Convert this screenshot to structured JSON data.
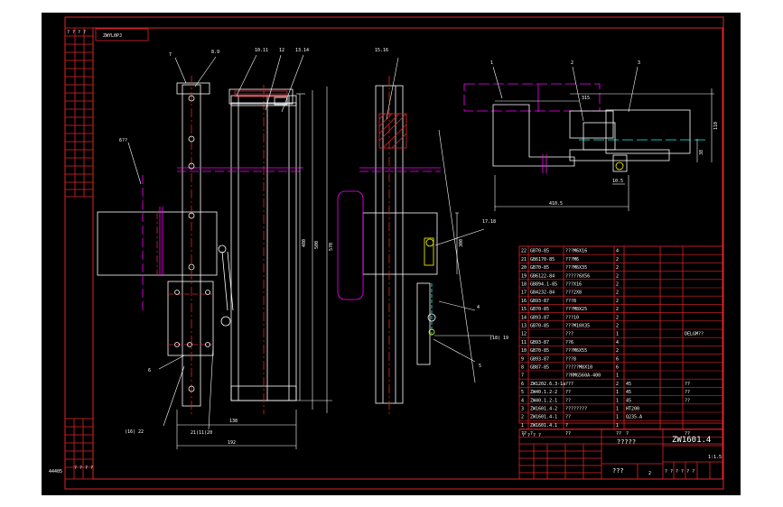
{
  "drawing": {
    "doc_code": "ZWYL0PJ",
    "side_code": "44405",
    "title_code": "ZW1601.4",
    "title_name": "?????",
    "scale": "1:1.5",
    "company": "???",
    "sheet": "2",
    "sign_marks": "? ? ? ? ? ?",
    "side_marks": "? ? ? ?",
    "corner_marks": "? ? ? ?",
    "bottom_marks": "? ? ? ?"
  },
  "front_view": {
    "balloons": [
      "7",
      "8.9",
      "10.11",
      "12",
      "13.14"
    ],
    "left_note": "6??",
    "dim_138": "138",
    "dim_192": "192",
    "dim_480": "480",
    "dim_500": "500",
    "dim_570": "570",
    "callout_6": "6",
    "callout_16_22": "(16)  22",
    "callout_21": "21(11)20"
  },
  "side_view": {
    "balloon_top": "15.16",
    "balloon_17_18": "17.18",
    "dim_300": "300",
    "callout_4": "4",
    "callout_5": "5",
    "callout_19": "(18)  19"
  },
  "top_view": {
    "balloons": [
      "1",
      "2",
      "3"
    ],
    "dim_315": "315",
    "dim_110": "110",
    "dim_38": "38",
    "dim_410": "410.5",
    "dim_105": "10.5"
  },
  "bom": {
    "rows": [
      {
        "no": "22",
        "code": "GB70-85",
        "name": "???M6X16",
        "qty": "4",
        "mat": "",
        "note": ""
      },
      {
        "no": "21",
        "code": "GB6170-85",
        "name": "???M6",
        "qty": "2",
        "mat": "",
        "note": ""
      },
      {
        "no": "20",
        "code": "GB70-85",
        "name": "???M6X35",
        "qty": "2",
        "mat": "",
        "note": ""
      },
      {
        "no": "19",
        "code": "GB6122-84",
        "name": "?????6X56",
        "qty": "2",
        "mat": "",
        "note": ""
      },
      {
        "no": "18",
        "code": "GB894.1-85",
        "name": "???X16",
        "qty": "2",
        "mat": "",
        "note": ""
      },
      {
        "no": "17",
        "code": "GB4232-84",
        "name": "???2X8",
        "qty": "2",
        "mat": "",
        "note": ""
      },
      {
        "no": "16",
        "code": "GB93-87",
        "name": "???8",
        "qty": "2",
        "mat": "",
        "note": ""
      },
      {
        "no": "15",
        "code": "GB70-85",
        "name": "???M8X25",
        "qty": "2",
        "mat": "",
        "note": ""
      },
      {
        "no": "14",
        "code": "GB93-87",
        "name": "???10",
        "qty": "2",
        "mat": "",
        "note": ""
      },
      {
        "no": "13",
        "code": "GB70-85",
        "name": "???M10X35",
        "qty": "2",
        "mat": "",
        "note": ""
      },
      {
        "no": "12",
        "code": "",
        "name": "???",
        "qty": "1",
        "mat": "",
        "note": "DELGM??"
      },
      {
        "no": "11",
        "code": "GB93-87",
        "name": "??6",
        "qty": "4",
        "mat": "",
        "note": ""
      },
      {
        "no": "10",
        "code": "GB70-85",
        "name": "???M6X55",
        "qty": "2",
        "mat": "",
        "note": ""
      },
      {
        "no": "9",
        "code": "GB93-87",
        "name": "???8",
        "qty": "6",
        "mat": "",
        "note": ""
      },
      {
        "no": "8",
        "code": "GB87-85",
        "name": "?????M8X10",
        "qty": "6",
        "mat": "",
        "note": ""
      },
      {
        "no": "7",
        "code": "",
        "name": "??RMG560A-400",
        "qty": "1",
        "mat": "",
        "note": ""
      },
      {
        "no": "6",
        "code": "ZW1202.6.3-1a",
        "name": "???",
        "qty": "2",
        "mat": "45",
        "note": "??"
      },
      {
        "no": "5",
        "code": "ZW40.1.2-2",
        "name": "??",
        "qty": "1",
        "mat": "45",
        "note": "??"
      },
      {
        "no": "4",
        "code": "ZW40.1.2-1",
        "name": "??",
        "qty": "1",
        "mat": "45",
        "note": "??"
      },
      {
        "no": "3",
        "code": "ZW1601.4-2",
        "name": "????????",
        "qty": "1",
        "mat": "HT200",
        "note": ""
      },
      {
        "no": "2",
        "code": "ZW1601.4-1",
        "name": "??",
        "qty": "1",
        "mat": "Q235-A",
        "note": ""
      },
      {
        "no": "1",
        "code": "ZW1601.4.1",
        "name": "?",
        "qty": "1",
        "mat": "",
        "note": ""
      }
    ],
    "header": {
      "no": "??",
      "code": "?",
      "name": "??",
      "qty": "??",
      "mat": "?",
      "note": "??"
    }
  },
  "colors": {
    "border": "#e0232a",
    "line": "#ffffff",
    "center": "#e0232a",
    "magenta": "#ff00ff",
    "cyan": "#00ffff",
    "green": "#00ff00",
    "yellow": "#ffff00",
    "background": "#000000"
  }
}
